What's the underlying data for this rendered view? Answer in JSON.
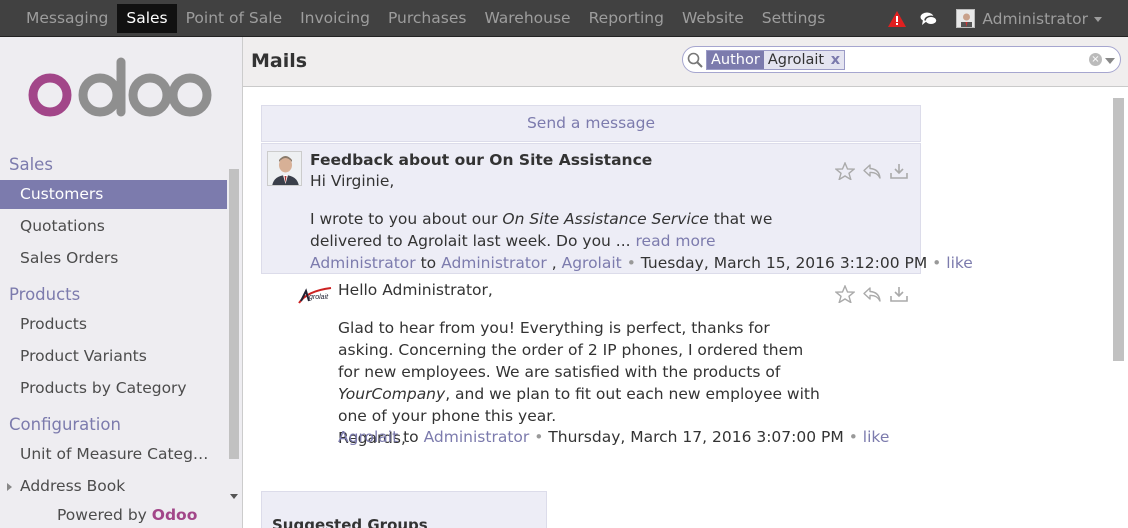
{
  "topmenu": {
    "items": [
      {
        "label": "Messaging",
        "active": false
      },
      {
        "label": "Sales",
        "active": true
      },
      {
        "label": "Point of Sale",
        "active": false
      },
      {
        "label": "Invoicing",
        "active": false
      },
      {
        "label": "Purchases",
        "active": false
      },
      {
        "label": "Warehouse",
        "active": false
      },
      {
        "label": "Reporting",
        "active": false
      },
      {
        "label": "Website",
        "active": false
      },
      {
        "label": "Settings",
        "active": false
      }
    ],
    "user": "Administrator"
  },
  "sidebar": {
    "sections": [
      {
        "title": "Sales",
        "items": [
          "Customers",
          "Quotations",
          "Sales Orders"
        ]
      },
      {
        "title": "Products",
        "items": [
          "Products",
          "Product Variants",
          "Products by Category"
        ]
      },
      {
        "title": "Configuration",
        "items": [
          "Unit of Measure Categ…",
          "Address Book"
        ]
      }
    ],
    "active_item": "Customers",
    "powered_by": "Powered by",
    "powered_brand": "Odoo"
  },
  "header": {
    "title": "Mails",
    "search": {
      "facet_category": "Author",
      "facet_value": "Agrolait",
      "facet_remove": "x"
    }
  },
  "main": {
    "send_message": "Send a message",
    "messages": [
      {
        "subject": "Feedback about our On Site Assistance",
        "greeting": "Hi Virginie,",
        "body_before": "I wrote to you about our ",
        "body_em": "On Site Assistance Service",
        "body_after": " that we delivered to Agrolait last week. Do you ... ",
        "read_more": "read more",
        "author": "Administrator",
        "to_word": "to",
        "recipient1": "Administrator",
        "comma": ",",
        "recipient2": "Agrolait",
        "date": "Tuesday, March 15, 2016 3:12:00 PM",
        "like": "like"
      },
      {
        "greeting": "Hello Administrator,",
        "body_before": "Glad to hear from you! Everything is perfect, thanks for asking. Concerning the order of 2 IP phones, I ordered them for new employees. We are satisfied with the products of ",
        "body_em": "YourCompany",
        "body_after": ", and we plan to fit out each new employee with one of your phone this year.",
        "regards": "Regards,",
        "author": "Agrolait",
        "to_word": "to",
        "recipient1": "Administrator",
        "date": "Thursday, March 17, 2016 3:07:00 PM",
        "like": "like"
      }
    ],
    "suggested_groups": "Suggested Groups"
  },
  "colors": {
    "accent": "#7c7bad",
    "topbar": "#414141",
    "brand": "#a24689",
    "alert": "#e02020"
  },
  "icons": [
    "alert-icon",
    "chat-icon",
    "search-icon",
    "clear-icon",
    "star-icon",
    "reply-icon",
    "download-icon"
  ]
}
